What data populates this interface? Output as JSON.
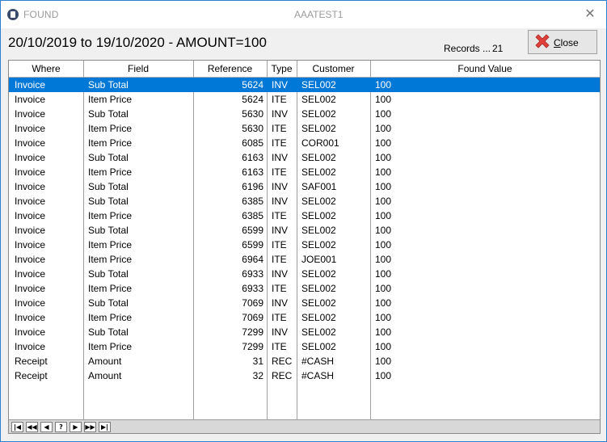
{
  "window": {
    "title_left": "FOUND",
    "title_center": "AAATEST1",
    "close_glyph": "✕"
  },
  "header": {
    "title": "20/10/2019 to 19/10/2020 - AMOUNT=100",
    "records_label": "Records ...",
    "records_count": "21",
    "close_label": "Close"
  },
  "table": {
    "columns": [
      "Where",
      "Field",
      "Reference",
      "Type",
      "Customer",
      "Found Value"
    ],
    "rows": [
      {
        "where": "Invoice",
        "field": "Sub Total",
        "reference": "5624",
        "type": "INV",
        "customer": "SEL002",
        "found": "100",
        "selected": true
      },
      {
        "where": "Invoice",
        "field": "Item Price",
        "reference": "5624",
        "type": "ITE",
        "customer": "SEL002",
        "found": "100"
      },
      {
        "where": "Invoice",
        "field": "Sub Total",
        "reference": "5630",
        "type": "INV",
        "customer": "SEL002",
        "found": "100"
      },
      {
        "where": "Invoice",
        "field": "Item Price",
        "reference": "5630",
        "type": "ITE",
        "customer": "SEL002",
        "found": "100"
      },
      {
        "where": "Invoice",
        "field": "Item Price",
        "reference": "6085",
        "type": "ITE",
        "customer": "COR001",
        "found": "100"
      },
      {
        "where": "Invoice",
        "field": "Sub Total",
        "reference": "6163",
        "type": "INV",
        "customer": "SEL002",
        "found": "100"
      },
      {
        "where": "Invoice",
        "field": "Item Price",
        "reference": "6163",
        "type": "ITE",
        "customer": "SEL002",
        "found": "100"
      },
      {
        "where": "Invoice",
        "field": "Sub Total",
        "reference": "6196",
        "type": "INV",
        "customer": "SAF001",
        "found": "100"
      },
      {
        "where": "Invoice",
        "field": "Sub Total",
        "reference": "6385",
        "type": "INV",
        "customer": "SEL002",
        "found": "100"
      },
      {
        "where": "Invoice",
        "field": "Item Price",
        "reference": "6385",
        "type": "ITE",
        "customer": "SEL002",
        "found": "100"
      },
      {
        "where": "Invoice",
        "field": "Sub Total",
        "reference": "6599",
        "type": "INV",
        "customer": "SEL002",
        "found": "100"
      },
      {
        "where": "Invoice",
        "field": "Item Price",
        "reference": "6599",
        "type": "ITE",
        "customer": "SEL002",
        "found": "100"
      },
      {
        "where": "Invoice",
        "field": "Item Price",
        "reference": "6964",
        "type": "ITE",
        "customer": "JOE001",
        "found": "100"
      },
      {
        "where": "Invoice",
        "field": "Sub Total",
        "reference": "6933",
        "type": "INV",
        "customer": "SEL002",
        "found": "100"
      },
      {
        "where": "Invoice",
        "field": "Item Price",
        "reference": "6933",
        "type": "ITE",
        "customer": "SEL002",
        "found": "100"
      },
      {
        "where": "Invoice",
        "field": "Sub Total",
        "reference": "7069",
        "type": "INV",
        "customer": "SEL002",
        "found": "100"
      },
      {
        "where": "Invoice",
        "field": "Item Price",
        "reference": "7069",
        "type": "ITE",
        "customer": "SEL002",
        "found": "100"
      },
      {
        "where": "Invoice",
        "field": "Sub Total",
        "reference": "7299",
        "type": "INV",
        "customer": "SEL002",
        "found": "100"
      },
      {
        "where": "Invoice",
        "field": "Item Price",
        "reference": "7299",
        "type": "ITE",
        "customer": "SEL002",
        "found": "100"
      },
      {
        "where": "Receipt",
        "field": "Amount",
        "reference": "31",
        "type": "REC",
        "customer": "#CASH",
        "found": "100"
      },
      {
        "where": "Receipt",
        "field": "Amount",
        "reference": "32",
        "type": "REC",
        "customer": "#CASH",
        "found": "100"
      }
    ]
  },
  "nav": {
    "buttons": [
      {
        "name": "first-record-button",
        "glyph": "|◀"
      },
      {
        "name": "previous-page-button",
        "glyph": "◀◀"
      },
      {
        "name": "previous-record-button",
        "glyph": "◀"
      },
      {
        "name": "help-button",
        "glyph": "?"
      },
      {
        "name": "next-record-button",
        "glyph": "▶"
      },
      {
        "name": "next-page-button",
        "glyph": "▶▶"
      },
      {
        "name": "last-record-button",
        "glyph": "▶|"
      }
    ]
  },
  "colors": {
    "selection": "#0078d7",
    "close_icon": "#e0403a"
  }
}
